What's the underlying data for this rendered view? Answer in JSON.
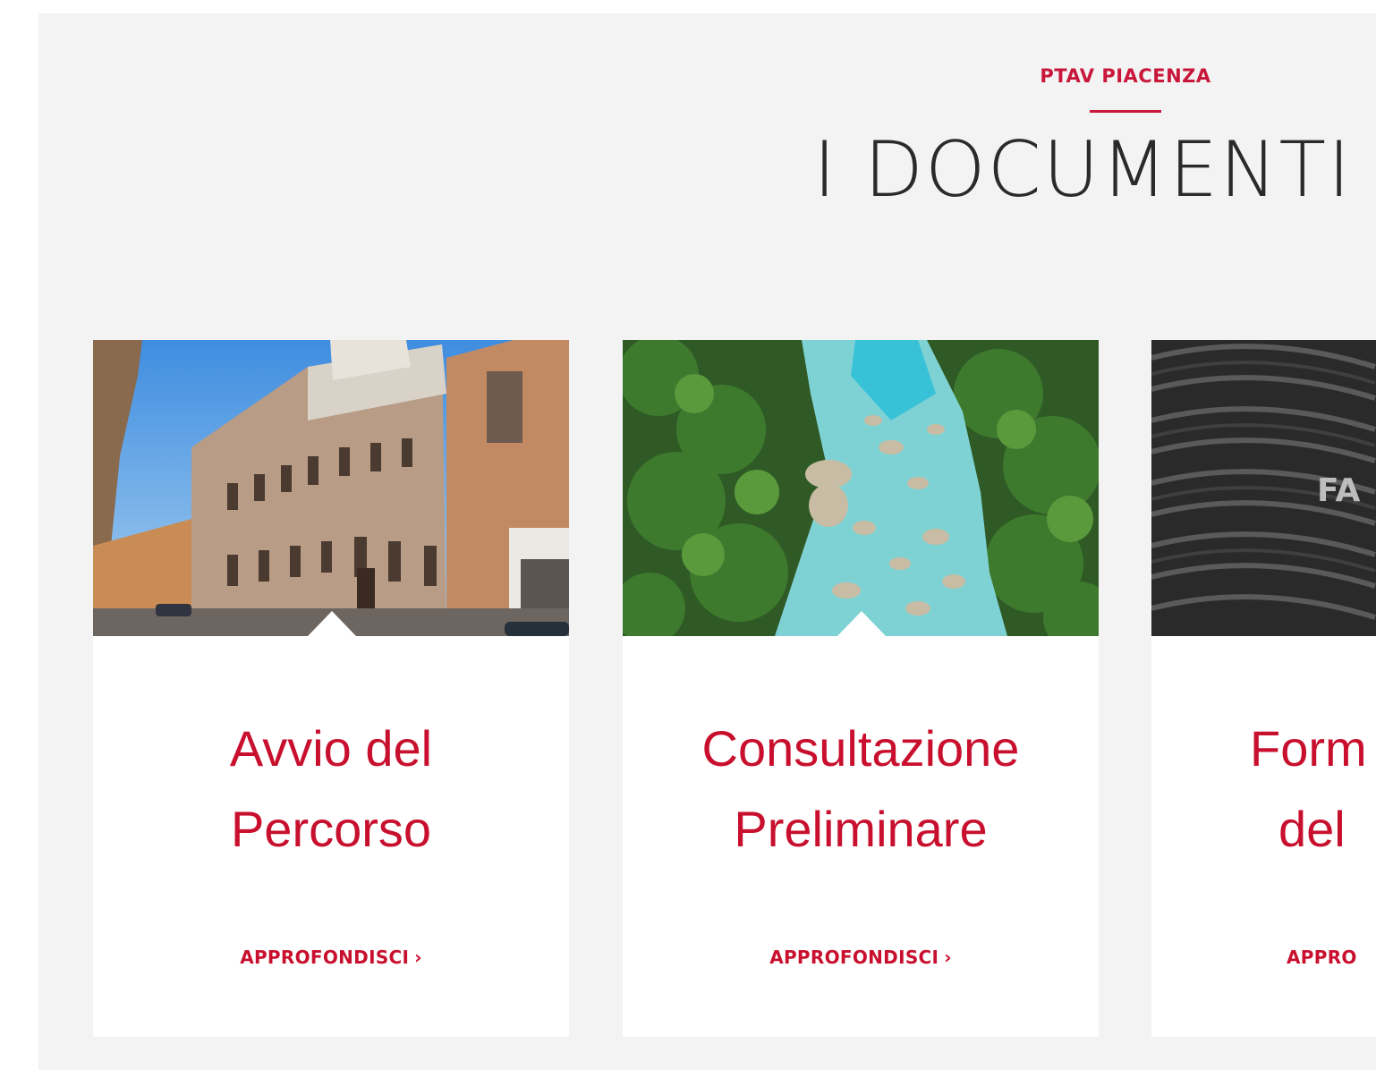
{
  "section": {
    "eyebrow": "PTAV PIACENZA",
    "title": "I DOCUMENTI"
  },
  "cards": [
    {
      "image": "palazzo-street-photo",
      "title_line1": "Avvio del",
      "title_line2": "Percorso",
      "link": "APPROFONDISCI",
      "chevron": "›"
    },
    {
      "image": "river-gorge-photo",
      "title_line1": "Consultazione",
      "title_line2": "Preliminare",
      "link": "APPROFONDISCI",
      "chevron": "›"
    },
    {
      "image": "vineyard-grayscale-photo",
      "image_text": "FA",
      "title_line1": "Form",
      "title_line2": "del",
      "link": "APPRO"
    }
  ],
  "colors": {
    "accent": "#c8102e",
    "section_bg": "#f3f3f3",
    "title_text": "#2a2a2a"
  }
}
